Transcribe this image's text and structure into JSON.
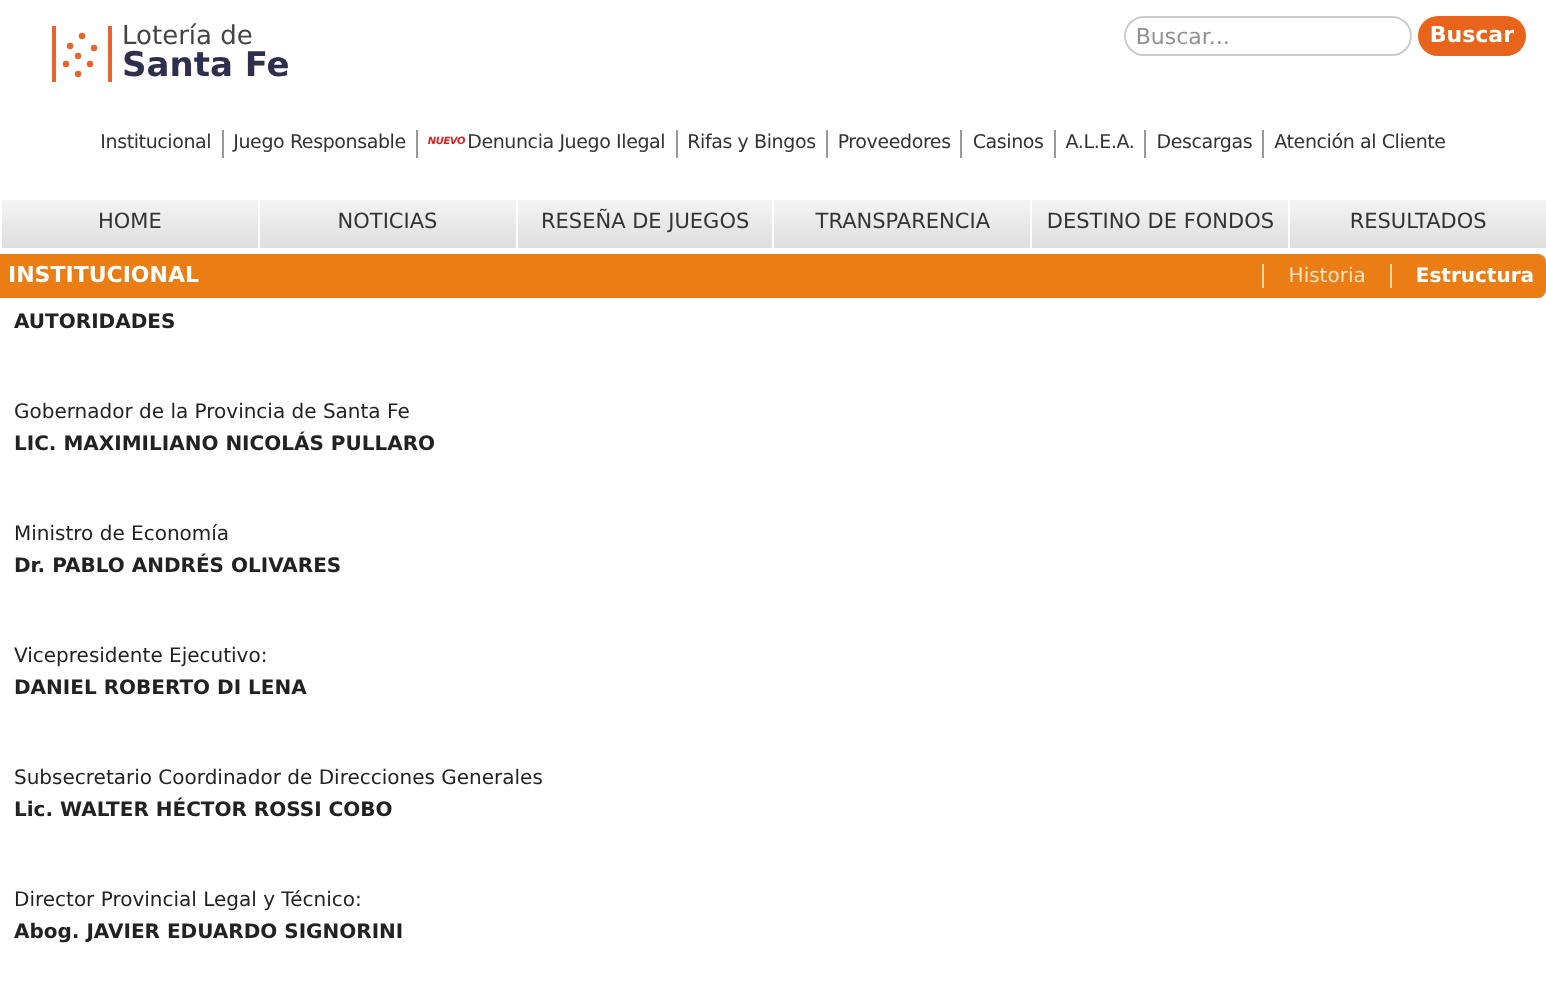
{
  "logo": {
    "line_1": "Lotería de",
    "line_2": "Santa Fe"
  },
  "search": {
    "placeholder": "Buscar...",
    "button": "Buscar"
  },
  "top_links": [
    {
      "label": "Institucional"
    },
    {
      "label": "Juego Responsable"
    },
    {
      "label": "Denuncia Juego Ilegal",
      "badge": "NUEVO"
    },
    {
      "label": "Rifas y Bingos"
    },
    {
      "label": "Proveedores"
    },
    {
      "label": "Casinos"
    },
    {
      "label": "A.L.E.A."
    },
    {
      "label": "Descargas"
    },
    {
      "label": "Atención al Cliente"
    }
  ],
  "main_nav": [
    "HOME",
    "NOTICIAS",
    "RESEÑA DE JUEGOS",
    "TRANSPARENCIA",
    "DESTINO DE FONDOS",
    "RESULTADOS"
  ],
  "section_bar": {
    "title": "INSTITUCIONAL",
    "links": [
      {
        "label": "Historia",
        "selected": false
      },
      {
        "label": "Estructura",
        "selected": true
      }
    ]
  },
  "content": {
    "heading": "AUTORIDADES",
    "authorities": [
      {
        "role": "Gobernador de la Provincia de Santa Fe",
        "name": "LIC. MAXIMILIANO NICOLÁS PULLARO"
      },
      {
        "role": "Ministro de Economía",
        "name": "Dr. PABLO ANDRÉS OLIVARES"
      },
      {
        "role": "Vicepresidente Ejecutivo:",
        "name": "DANIEL ROBERTO DI LENA"
      },
      {
        "role": "Subsecretario Coordinador de Direcciones Generales",
        "name": "Lic. WALTER HÉCTOR ROSSI COBO"
      },
      {
        "role": "Director Provincial Legal y Técnico:",
        "name": "Abog. JAVIER EDUARDO SIGNORINI"
      }
    ]
  }
}
